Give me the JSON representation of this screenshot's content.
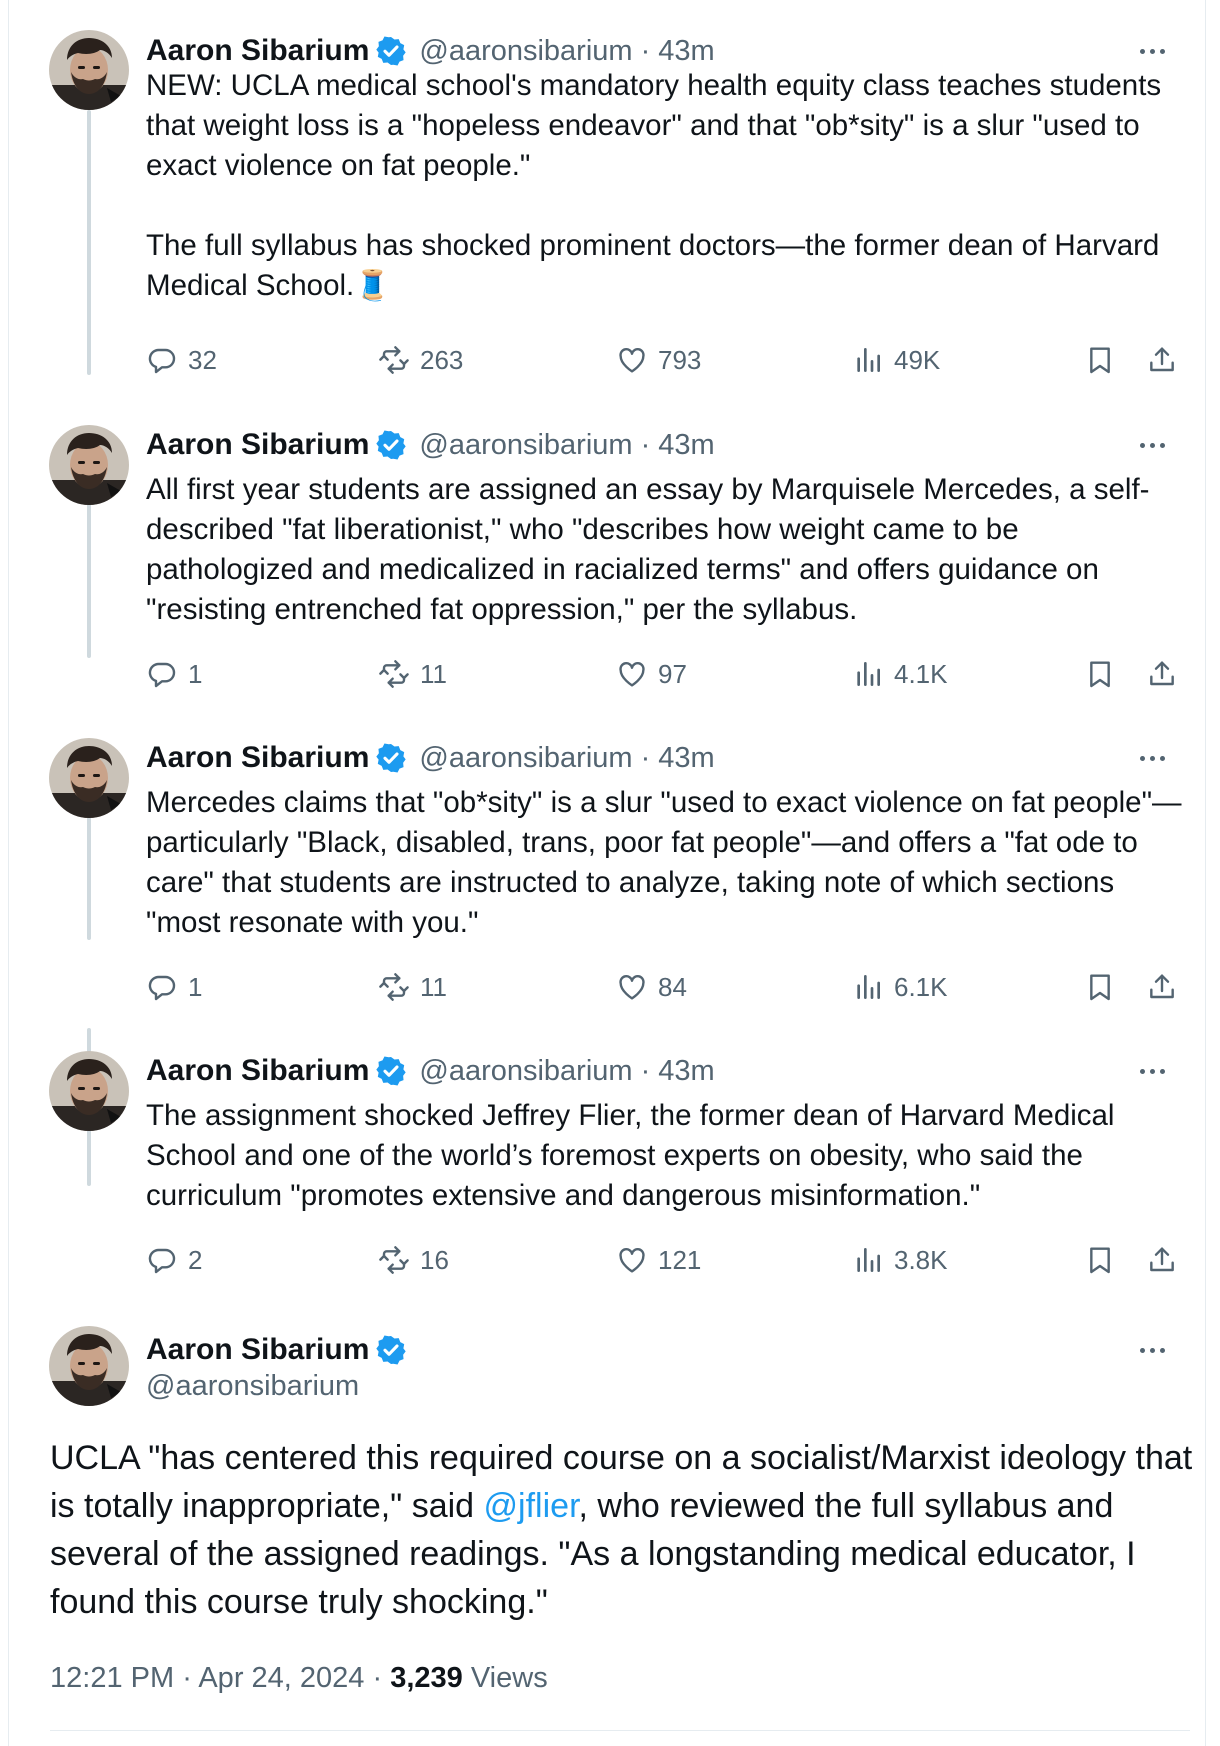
{
  "author": {
    "name": "Aaron Sibarium",
    "handle": "@aaronsibarium",
    "verified_color": "#1d9bf0"
  },
  "separator": "·",
  "thread": [
    {
      "time": "43m",
      "text": "NEW: UCLA medical school's mandatory health equity class teaches students that weight loss is a \"hopeless endeavor\" and that \"ob*sity\" is a slur \"used to exact violence on fat people.\"\n\nThe full syllabus has shocked prominent doctors—the former dean of Harvard Medical School.🧵",
      "replies": "32",
      "reposts": "263",
      "likes": "793",
      "views": "49K"
    },
    {
      "time": "43m",
      "text": "All first year students are assigned an essay by Marquisele Mercedes, a self-described \"fat liberationist,\" who \"describes how weight came to be pathologized and medicalized in racialized terms\" and offers guidance on \"resisting entrenched fat oppression,\" per the syllabus.",
      "replies": "1",
      "reposts": "11",
      "likes": "97",
      "views": "4.1K"
    },
    {
      "time": "43m",
      "text": "Mercedes claims that \"ob*sity\" is a slur \"used to exact violence on fat people\"—particularly \"Black, disabled, trans, poor fat people\"—and offers a \"fat ode to care\" that students are instructed to analyze, taking note of which sections \"most resonate with you.\"",
      "replies": "1",
      "reposts": "11",
      "likes": "84",
      "views": "6.1K"
    },
    {
      "time": "43m",
      "text": "The assignment shocked Jeffrey Flier, the former dean of Harvard Medical School and one of the world’s foremost experts on obesity, who said the curriculum \"promotes extensive and dangerous misinformation.\"",
      "replies": "2",
      "reposts": "16",
      "likes": "121",
      "views": "3.8K"
    }
  ],
  "main_tweet": {
    "text_before": "UCLA \"has centered this required course on a socialist/Marxist ideology that is totally inappropriate,\" said ",
    "mention": "@jflier",
    "text_after": ", who reviewed the full syllabus and several of the assigned readings. \"As a longstanding medical educator, I found this course truly shocking.\"",
    "time": "12:21 PM",
    "date": "Apr 24, 2024",
    "views_count": "3,239",
    "views_label": "Views"
  },
  "icons": [
    "avatar",
    "verified-badge-icon",
    "more-icon",
    "reply-icon",
    "repost-icon",
    "like-icon",
    "views-icon",
    "bookmark-icon",
    "share-icon"
  ]
}
